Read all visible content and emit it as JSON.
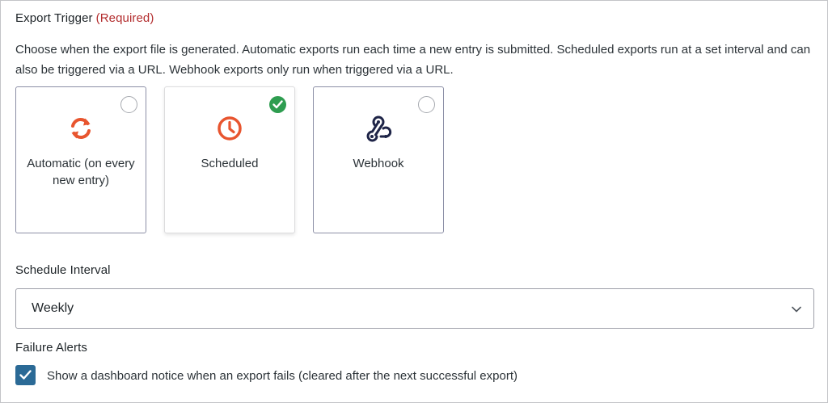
{
  "export_trigger": {
    "label": "Export Trigger",
    "required_text": "(Required)",
    "description": "Choose when the export file is generated. Automatic exports run each time a new entry is submitted. Scheduled exports run at a set interval and can also be triggered via a URL. Webhook exports only run when triggered via a URL.",
    "options": [
      {
        "label": "Automatic (on every new entry)",
        "icon": "sync-icon",
        "selected": false
      },
      {
        "label": "Scheduled",
        "icon": "clock-icon",
        "selected": true
      },
      {
        "label": "Webhook",
        "icon": "webhook-icon",
        "selected": false
      }
    ]
  },
  "schedule_interval": {
    "label": "Schedule Interval",
    "value": "Weekly"
  },
  "failure_alerts": {
    "label": "Failure Alerts",
    "checkbox_label": "Show a dashboard notice when an export fails (cleared after the next successful export)",
    "checked": true
  },
  "colors": {
    "accent_orange": "#e8552f",
    "selected_green": "#2e9d50",
    "required_red": "#b32d2e",
    "checkbox_blue": "#2b6a96",
    "webhook_navy": "#1e2447"
  }
}
